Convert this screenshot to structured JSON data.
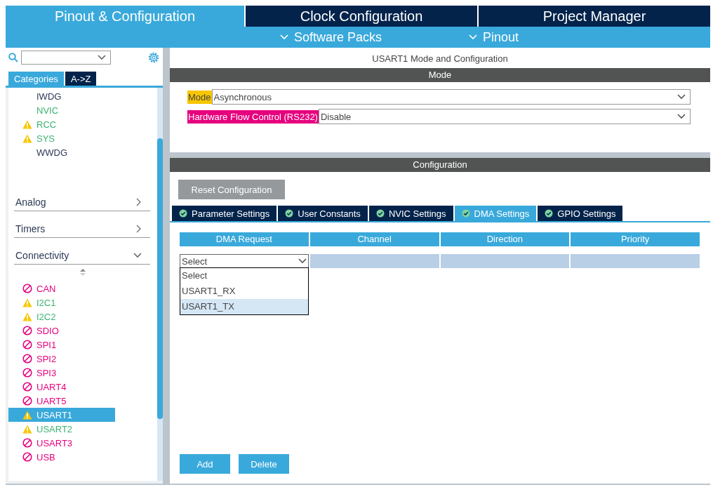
{
  "header": {
    "tabs": [
      {
        "label": "Pinout & Configuration",
        "selected": true
      },
      {
        "label": "Clock Configuration",
        "selected": false
      },
      {
        "label": "Project Manager",
        "selected": false
      }
    ],
    "menus": [
      {
        "label": "Software Packs"
      },
      {
        "label": "Pinout"
      }
    ]
  },
  "sidebar": {
    "view_tabs": [
      {
        "label": "Categories",
        "selected": true
      },
      {
        "label": "A->Z",
        "selected": false
      }
    ],
    "items": [
      {
        "label": "IWDG",
        "kind": "none",
        "selected": false
      },
      {
        "label": "NVIC",
        "kind": "ok",
        "selected": false
      },
      {
        "label": "RCC",
        "kind": "warning",
        "selected": false
      },
      {
        "label": "SYS",
        "kind": "warning",
        "selected": false
      },
      {
        "label": "WWDG",
        "kind": "none",
        "selected": false
      }
    ],
    "categories": [
      {
        "label": "Analog",
        "expanded": false
      },
      {
        "label": "Timers",
        "expanded": false
      },
      {
        "label": "Connectivity",
        "expanded": true,
        "children": [
          {
            "label": "CAN",
            "kind": "blocked",
            "selected": false
          },
          {
            "label": "I2C1",
            "kind": "warning",
            "selected": false
          },
          {
            "label": "I2C2",
            "kind": "warning",
            "selected": false
          },
          {
            "label": "SDIO",
            "kind": "blocked",
            "selected": false
          },
          {
            "label": "SPI1",
            "kind": "blocked",
            "selected": false
          },
          {
            "label": "SPI2",
            "kind": "blocked",
            "selected": false
          },
          {
            "label": "SPI3",
            "kind": "blocked",
            "selected": false
          },
          {
            "label": "UART4",
            "kind": "blocked",
            "selected": false
          },
          {
            "label": "UART5",
            "kind": "blocked",
            "selected": false
          },
          {
            "label": "USART1",
            "kind": "warning",
            "selected": true
          },
          {
            "label": "USART2",
            "kind": "warning",
            "selected": false
          },
          {
            "label": "USART3",
            "kind": "blocked",
            "selected": false
          },
          {
            "label": "USB",
            "kind": "blocked",
            "selected": false
          }
        ]
      }
    ]
  },
  "main": {
    "title": "USART1 Mode and Configuration",
    "mode": {
      "header": "Mode",
      "fields": [
        {
          "label": "Mode",
          "value": "Asynchronous",
          "color": "#f7c600"
        },
        {
          "label": "Hardware Flow Control (RS232)",
          "value": "Disable",
          "color": "#e6007e"
        }
      ]
    },
    "configuration": {
      "header": "Configuration",
      "reset_button": "Reset Configuration",
      "tabs": [
        {
          "label": "Parameter Settings",
          "selected": false
        },
        {
          "label": "User Constants",
          "selected": false
        },
        {
          "label": "NVIC Settings",
          "selected": false
        },
        {
          "label": "DMA Settings",
          "selected": true
        },
        {
          "label": "GPIO Settings",
          "selected": false
        }
      ],
      "table": {
        "columns": [
          "DMA Request",
          "Channel",
          "Direction",
          "Priority"
        ],
        "rows": [
          {
            "dma_request": "Select",
            "expanded": true,
            "options": [
              {
                "label": "Select",
                "selected": false
              },
              {
                "label": "USART1_RX",
                "selected": false
              },
              {
                "label": "USART1_TX",
                "selected": true
              }
            ]
          }
        ]
      },
      "buttons": [
        "Add",
        "Delete"
      ]
    }
  }
}
